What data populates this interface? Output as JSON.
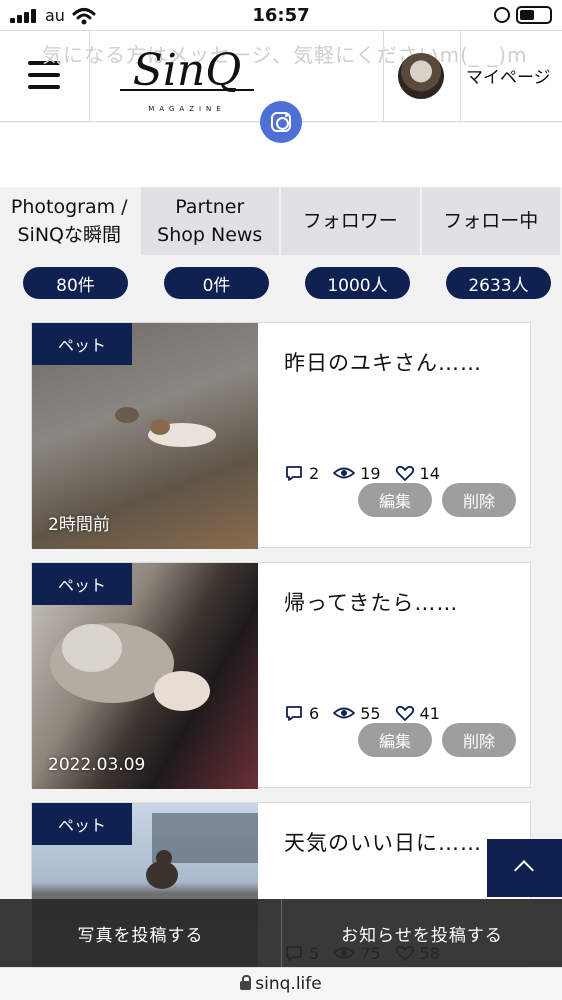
{
  "status_bar": {
    "carrier": "au",
    "time": "16:57"
  },
  "header": {
    "ticker": "気になる方はメッセージ、気軽にくださいm(_ _)m",
    "logo_text": "SinQ",
    "logo_sub": "MAGAZINE",
    "mypage_label": "マイページ"
  },
  "tabs": [
    {
      "line1": "Photogram /",
      "line2": "SiNQな瞬間"
    },
    {
      "line1": "Partner",
      "line2": "Shop News"
    },
    {
      "line1": "フォロワー",
      "line2": ""
    },
    {
      "line1": "フォロー中",
      "line2": ""
    }
  ],
  "counts": [
    "80件",
    "0件",
    "1000人",
    "2633人"
  ],
  "posts": [
    {
      "category": "ペット",
      "date": "2時間前",
      "title": "昨日のユキさん……",
      "comments": "2",
      "views": "19",
      "likes": "14"
    },
    {
      "category": "ペット",
      "date": "2022.03.09",
      "title": "帰ってきたら……",
      "comments": "6",
      "views": "55",
      "likes": "41"
    },
    {
      "category": "ペット",
      "date": "",
      "title": "天気のいい日に……",
      "comments": "5",
      "views": "75",
      "likes": "58"
    }
  ],
  "buttons": {
    "edit": "編集",
    "delete": "削除"
  },
  "bottom_bar": {
    "post_photo": "写真を投稿する",
    "post_news": "お知らせを投稿する"
  },
  "url": "sinq.life",
  "colors": {
    "navy": "#0e2150",
    "instagram": "#4e6fd6",
    "tab_bg": "#dfe1e6",
    "button_gray": "#9e9e9e"
  },
  "icons": [
    "signal-icon",
    "wifi-icon",
    "rotation-lock-icon",
    "battery-icon",
    "menu-icon",
    "instagram-icon",
    "comment-icon",
    "eye-icon",
    "heart-icon",
    "chevron-up-icon",
    "lock-icon"
  ]
}
